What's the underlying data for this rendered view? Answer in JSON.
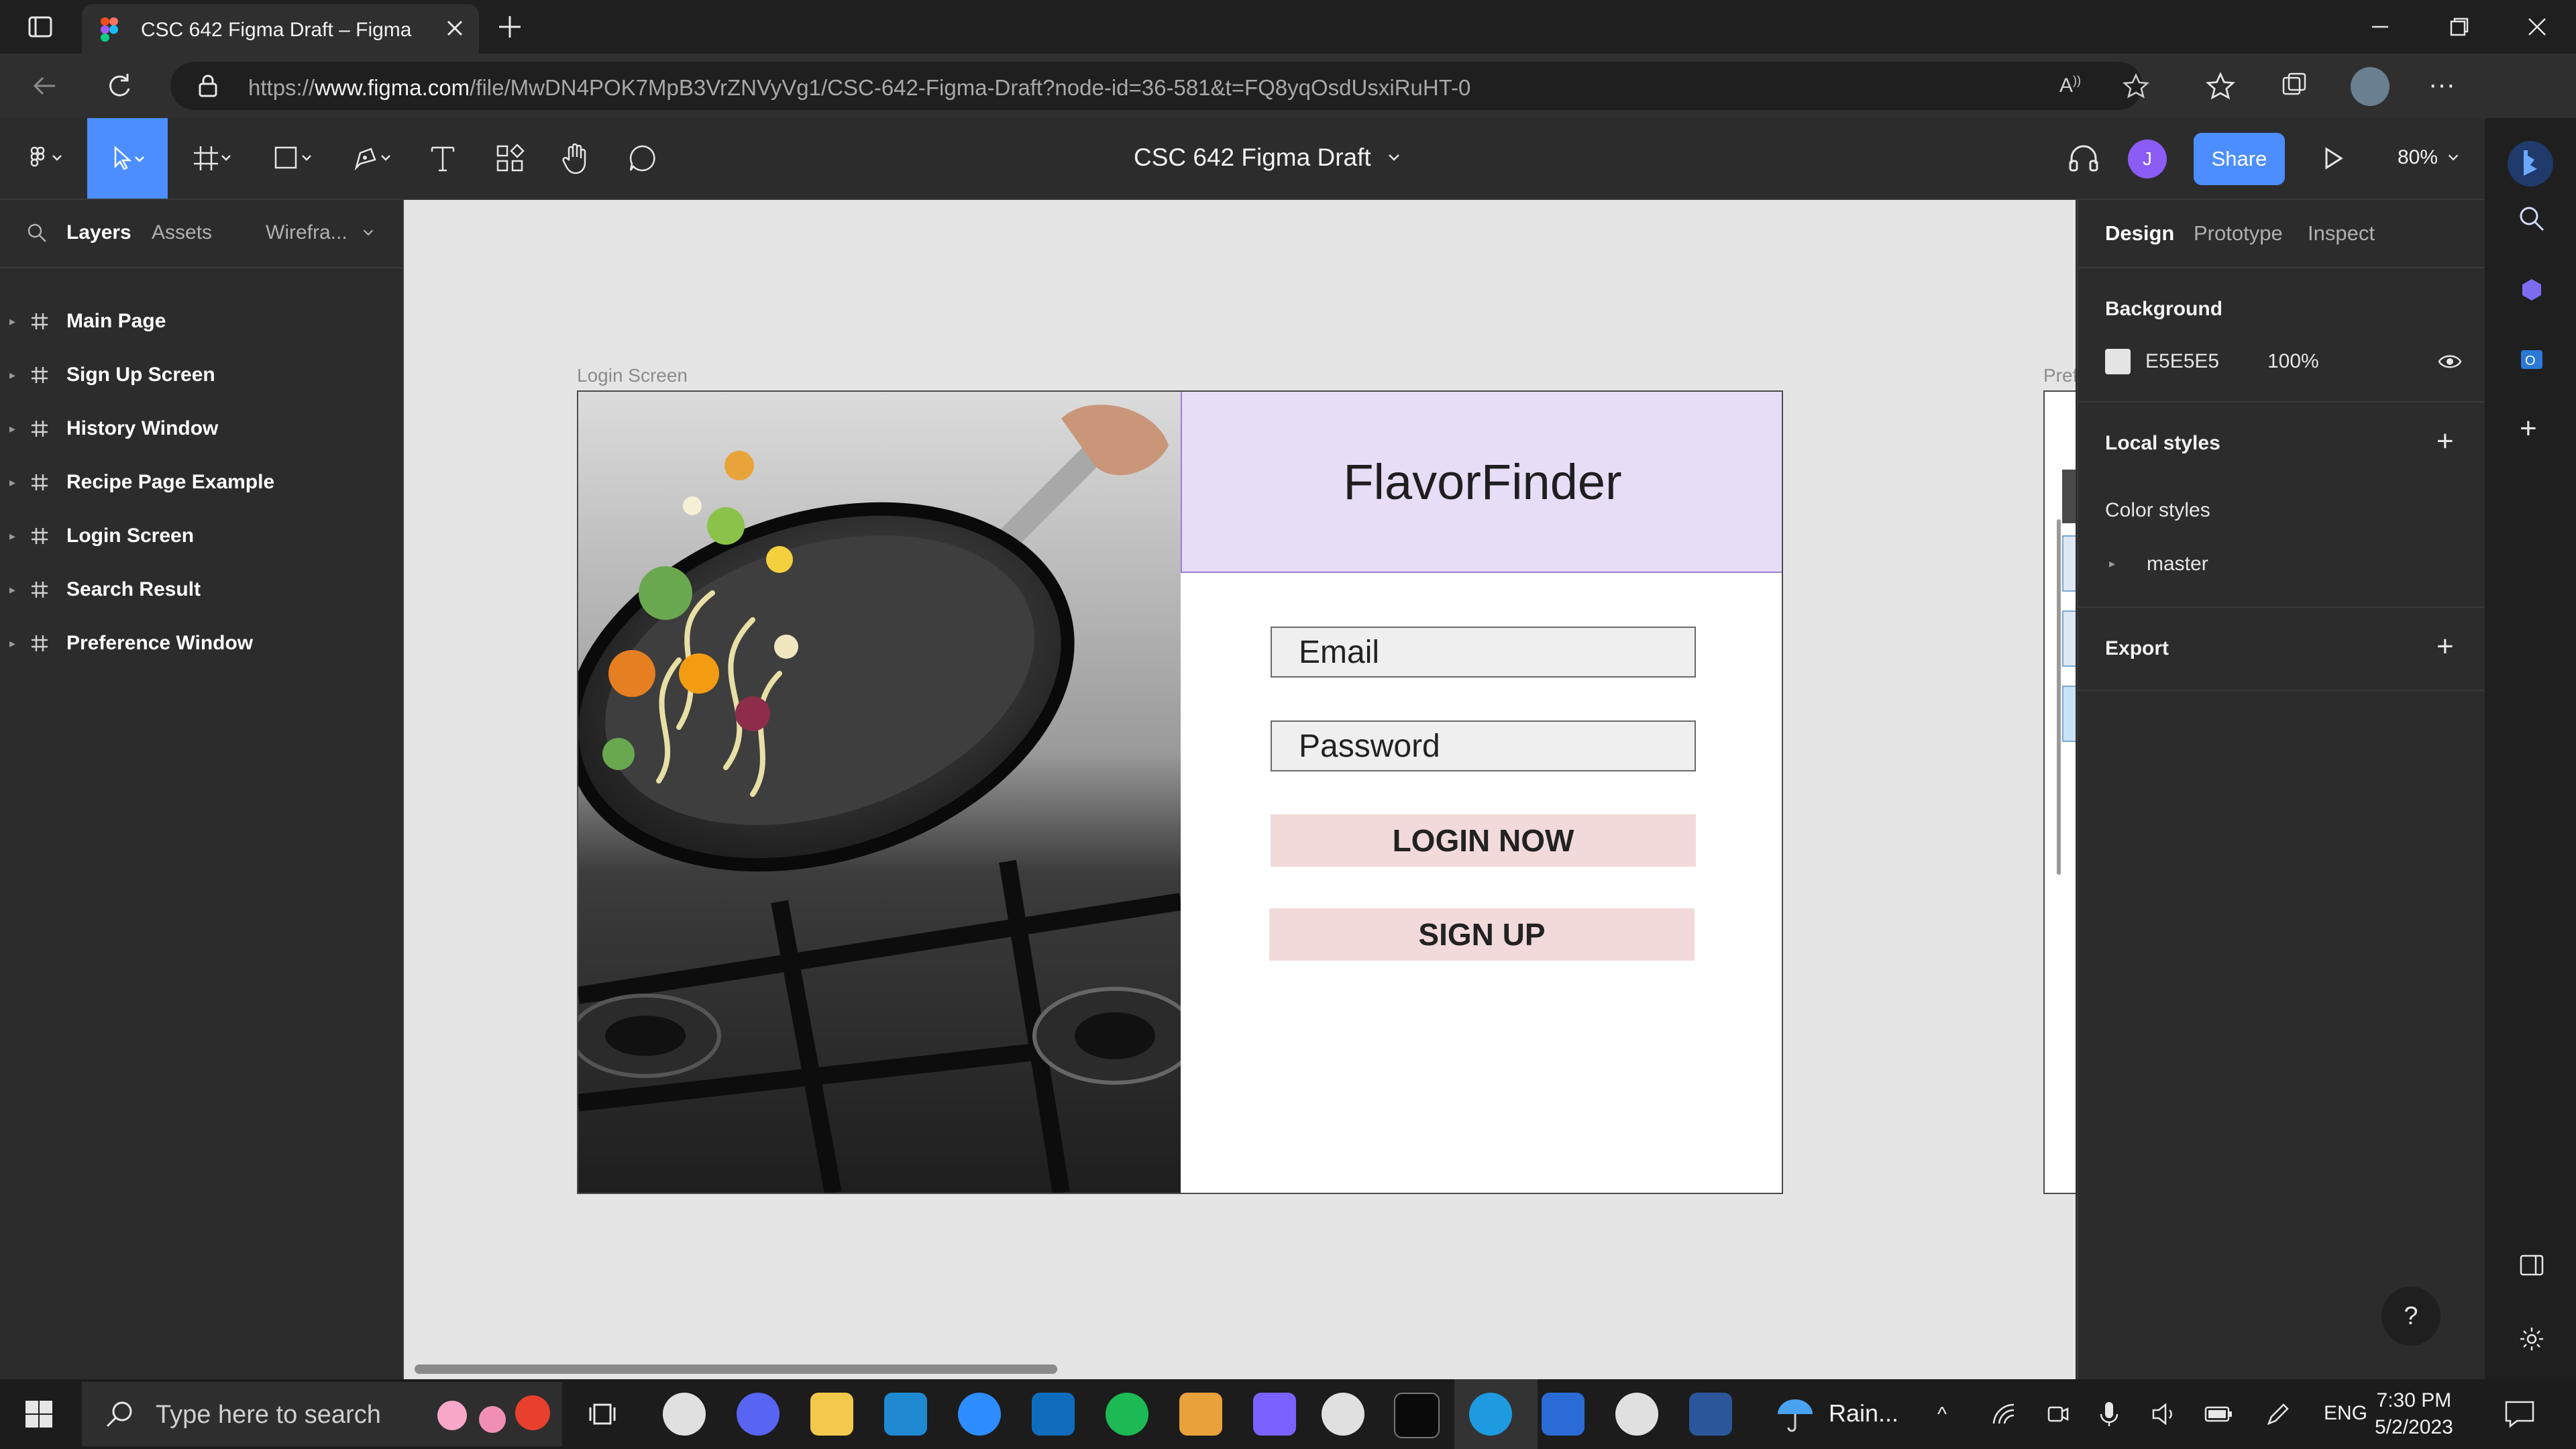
{
  "browser": {
    "tab_title": "CSC 642 Figma Draft – Figma",
    "url_prefix": "https://",
    "url_domain": "www.figma.com",
    "url_path": "/file/MwDN4POK7MpB3VrZNVyVg1/CSC-642-Figma-Draft?node-id=36-581&t=FQ8yqOsdUsxiRuHT-0"
  },
  "toolbar": {
    "file_title": "CSC 642 Figma Draft",
    "avatar_initial": "J",
    "share_label": "Share",
    "zoom": "80%"
  },
  "left_panel": {
    "tabs": [
      "Layers",
      "Assets",
      "Wirefra..."
    ],
    "layers": [
      {
        "label": "Main Page"
      },
      {
        "label": "Sign Up Screen"
      },
      {
        "label": "History Window"
      },
      {
        "label": "Recipe Page Example"
      },
      {
        "label": "Login Screen"
      },
      {
        "label": "Search Result"
      },
      {
        "label": "Preference Window"
      }
    ]
  },
  "canvas": {
    "frame_label": "Login Screen",
    "right_frame_label": "Pref",
    "brand": "FlavorFinder",
    "email_placeholder": "Email",
    "password_placeholder": "Password",
    "login_button": "LOGIN NOW",
    "signup_button": "SIGN UP"
  },
  "right_panel": {
    "tabs": [
      "Design",
      "Prototype",
      "Inspect"
    ],
    "background_heading": "Background",
    "background_color": "E5E5E5",
    "background_opacity": "100%",
    "local_styles_heading": "Local styles",
    "color_styles_label": "Color styles",
    "master_label": "master",
    "export_heading": "Export"
  },
  "taskbar": {
    "search_placeholder": "Type here to search",
    "weather": "Rain...",
    "language": "ENG",
    "time": "7:30 PM",
    "date": "5/2/2023"
  },
  "colors": {
    "accent": "#4c8eff",
    "banner": "#e7ddf7",
    "button": "#f2dadb",
    "canvas": "#e5e5e5"
  }
}
